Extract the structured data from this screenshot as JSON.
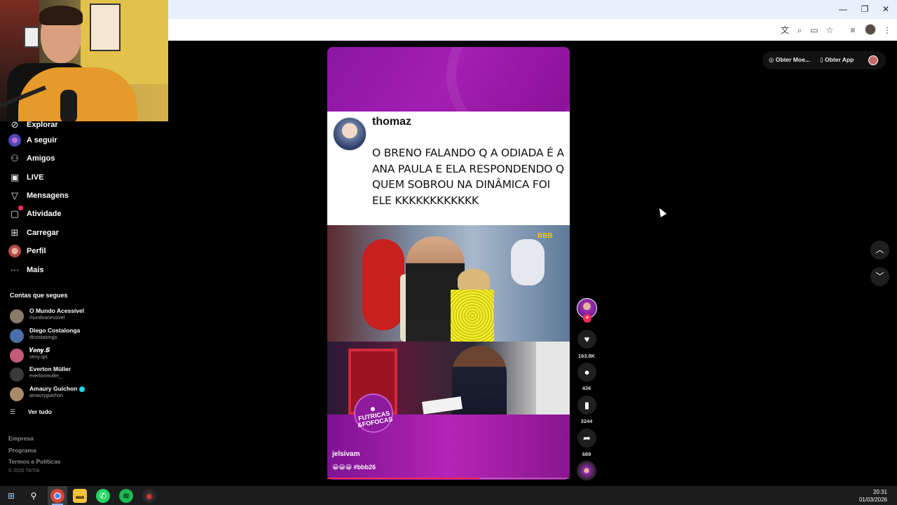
{
  "window": {
    "minimize_glyph": "—",
    "restore_glyph": "❐",
    "close_glyph": "✕"
  },
  "toolbar": {
    "icons": [
      "translate-icon",
      "zoom-icon",
      "cast-icon",
      "bookmark-star-icon",
      "reading-list-icon",
      "profile-icon",
      "more-icon"
    ]
  },
  "sidebar": {
    "nav": [
      {
        "label": "Explorar",
        "icon": "compass-icon"
      },
      {
        "label": "A seguir",
        "icon": "following-avatar-icon"
      },
      {
        "label": "Amigos",
        "icon": "friends-icon"
      },
      {
        "label": "LIVE",
        "icon": "live-icon"
      },
      {
        "label": "Mensagens",
        "icon": "send-icon"
      },
      {
        "label": "Atividade",
        "icon": "activity-icon"
      },
      {
        "label": "Carregar",
        "icon": "upload-icon"
      },
      {
        "label": "Perfil",
        "icon": "profile-avatar-icon"
      },
      {
        "label": "Mais",
        "icon": "more-dots-icon"
      }
    ],
    "following_title": "Contas que segues",
    "accounts": [
      {
        "name": "O Mundo Acessível",
        "handle": "mundoacessivel",
        "color": "#8a7a6a"
      },
      {
        "name": "Diego Costalonga",
        "handle": "dicostalonga",
        "color": "#4a6ea8"
      },
      {
        "name": "𝑽𝒆𝒏𝒚.𝑺",
        "handle": "veny.spt",
        "color": "#c35a7a"
      },
      {
        "name": "Everton Müller",
        "handle": "evertonmuller_",
        "color": "#3a3a3a"
      },
      {
        "name": "Amaury Guichon",
        "handle": "amauryguichon",
        "color": "#a88a6a",
        "verified": true
      }
    ],
    "see_all": "Ver tudo",
    "footer": [
      "Empresa",
      "Programa",
      "Termos e Políticas"
    ],
    "copyright": "© 2026 TikTok"
  },
  "topright": {
    "coins": "Obter Moe...",
    "app": "Obter App"
  },
  "video": {
    "tweet_name": "thomaz",
    "tweet_text": "O BRENO FALANDO Q A ODIADA É A ANA PAULA E ELA RESPONDENDO Q QUEM SOBROU NA DINÂMICA FOI ELE KKKKKKKKKKKK",
    "bbb_mark": "BBB",
    "logo_line1": "FUTRICAS",
    "logo_line2": "&FOFOCAS",
    "author": "jelsivam",
    "caption": "😀😀😀 #bbb26",
    "progress": 0.63
  },
  "actions": {
    "likes": "163.8K",
    "comments": "436",
    "saves": "3244",
    "shares": "689"
  },
  "taskbar": {
    "time": "20:31",
    "date": "01/03/2026"
  },
  "colors": {
    "accent": "#fe2c55",
    "video_purple": "#9a1aa5"
  }
}
